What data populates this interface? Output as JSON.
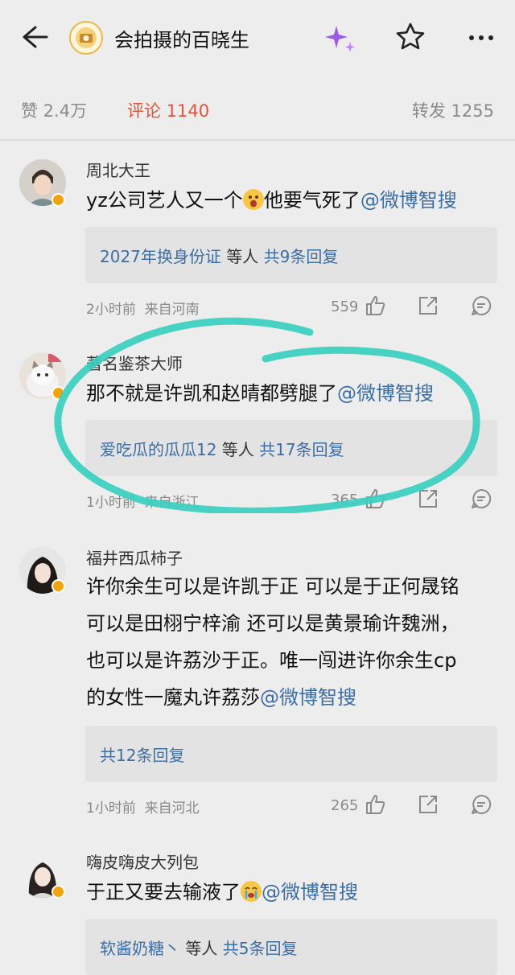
{
  "header": {
    "account_name": "会拍摄的百晓生",
    "icons": [
      "back-arrow-icon",
      "sparkle-icon",
      "star-icon",
      "more-icon"
    ]
  },
  "stats": {
    "likes": "赞 2.4万",
    "comments": "评论 1140",
    "reposts": "转发 1255"
  },
  "colors": {
    "accent_red": "#e2533e",
    "link_blue": "#3b6ea5",
    "annotation_teal": "#39cfc0",
    "badge_orange": "#f0a40e"
  },
  "comments": [
    {
      "user": "周北大王",
      "text_before": "yz公司艺人又一个",
      "text_after": "他要气死了",
      "mention": "@微博智搜",
      "replies_user": "2027年换身份证",
      "replies_deng": " 等人 ",
      "replies_count": "共9条回复",
      "time": "2小时前",
      "location": "来自河南",
      "likes": "559"
    },
    {
      "user": "著名鉴茶大师",
      "text": "那不就是许凯和赵晴都劈腿了",
      "mention": "@微博智搜",
      "replies_user": "爱吃瓜的瓜瓜12",
      "replies_deng": " 等人 ",
      "replies_count": "共17条回复",
      "time": "1小时前",
      "location": "来自浙江",
      "likes": "365"
    },
    {
      "user": "福井西瓜柿子",
      "lines": [
        "许你余生可以是许凯于正 可以是于正何晟铭",
        "可以是田栩宁梓渝 还可以是黄景瑜许魏洲，",
        "也可以是许荔沙于正。唯一闯进许你余生cp",
        "的女性一魔丸许荔莎"
      ],
      "mention": "@微博智搜",
      "replies_count": "共12条回复",
      "time": "1小时前",
      "location": "来自河北",
      "likes": "265"
    },
    {
      "user": "嗨皮嗨皮大列包",
      "text": "于正又要去输液了",
      "mention": "@微博智搜",
      "replies_user": "软酱奶糖丶",
      "replies_deng": " 等人 ",
      "replies_count": "共5条回复"
    }
  ]
}
